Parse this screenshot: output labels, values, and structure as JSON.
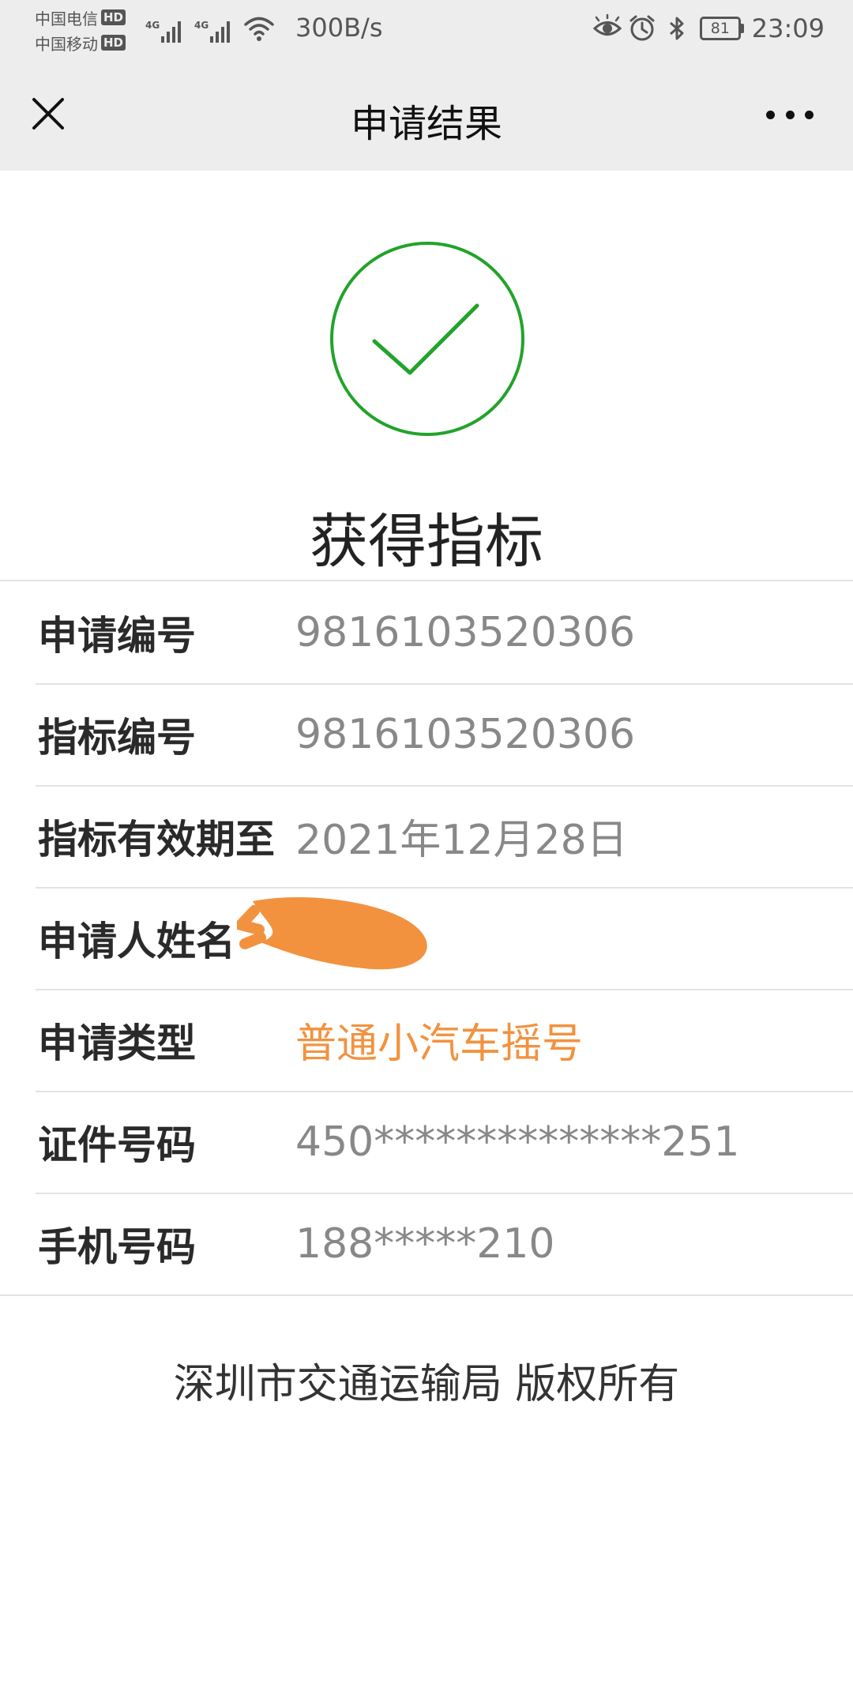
{
  "status_bar": {
    "carrier_1": "中国电信",
    "carrier_2": "中国移动",
    "hd_badge": "HD",
    "network_tag_1": "4G",
    "network_tag_2": "4G",
    "net_speed": "300B/s",
    "battery_level": "81",
    "time": "23:09",
    "icons": [
      "eye-icon",
      "alarm-icon",
      "bluetooth-icon",
      "wifi-icon"
    ]
  },
  "nav": {
    "title": "申请结果",
    "close_icon": "close-icon",
    "more_icon": "more-icon"
  },
  "result": {
    "icon": "check-circle-icon",
    "title": "获得指标",
    "accent_color": "#22a32a"
  },
  "info": {
    "rows": [
      {
        "label": "申请编号",
        "value": "9816103520306"
      },
      {
        "label": "指标编号",
        "value": "9816103520306"
      },
      {
        "label": "指标有效期至",
        "value": "2021年12月28日"
      },
      {
        "label": "申请人姓名",
        "value": ""
      },
      {
        "label": "申请类型",
        "value": "普通小汽车摇号"
      },
      {
        "label": "证件号码",
        "value": "450**************251"
      },
      {
        "label": "手机号码",
        "value": "188*****210"
      }
    ],
    "highlight_color": "#f2923f"
  },
  "footer": {
    "copyright": "深圳市交通运输局 版权所有"
  }
}
